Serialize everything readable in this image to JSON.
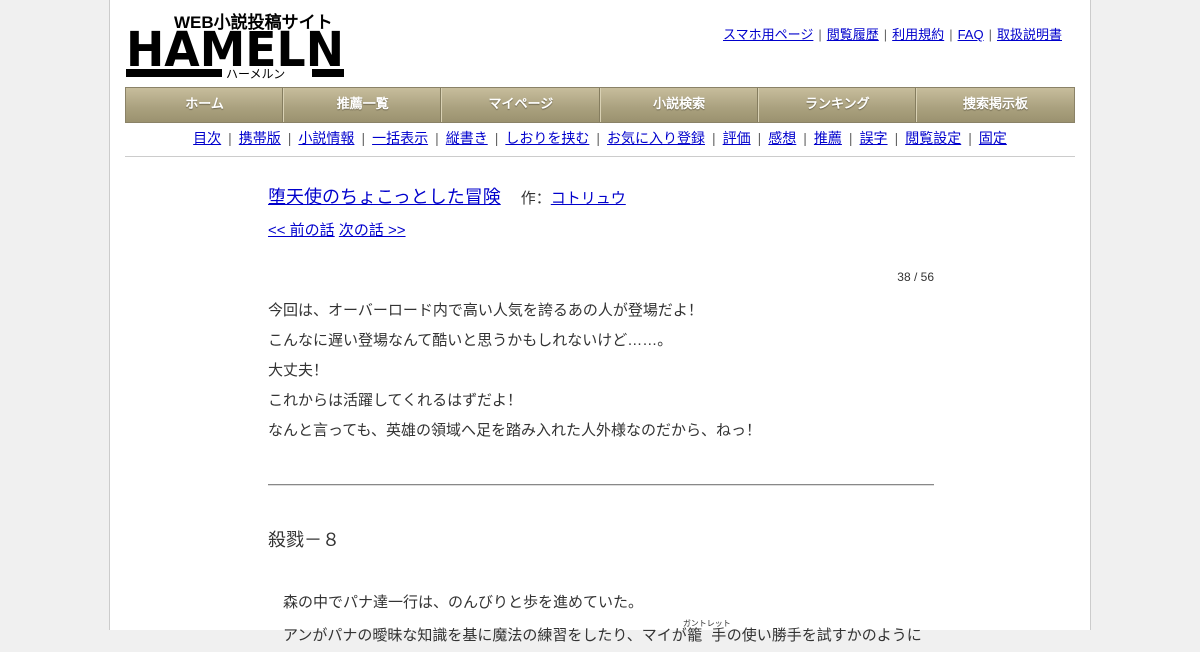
{
  "logo": {
    "small_text": "WEB小説投稿サイト",
    "main_text": "HAMELN",
    "kana_text": "ハーメルン"
  },
  "top_links": [
    "スマホ用ページ",
    "閲覧履歴",
    "利用規約",
    "FAQ",
    "取扱説明書"
  ],
  "main_nav": [
    "ホーム",
    "推薦一覧",
    "マイページ",
    "小説検索",
    "ランキング",
    "捜索掲示板"
  ],
  "sub_nav": [
    "目次",
    "携帯版",
    "小説情報",
    "一括表示",
    "縦書き",
    "しおりを挟む",
    "お気に入り登録",
    "評価",
    "感想",
    "推薦",
    "誤字",
    "閲覧設定",
    "固定"
  ],
  "novel": {
    "title": "堕天使のちょこっとした冒険",
    "author_prefix": "作：",
    "author": "コトリュウ",
    "prev": "<< 前の話",
    "next": "次の話 >>",
    "episode_count": "38 / 56",
    "foreword": [
      "今回は、オーバーロード内で高い人気を誇るあの人が登場だよ！",
      "こんなに遅い登場なんて酷いと思うかもしれないけど……。",
      "大丈夫！",
      "これからは活躍してくれるはずだよ！",
      "なんと言っても、英雄の領域へ足を踏み入れた人外様なのだから、ねっ！"
    ],
    "chapter_title": "殺戮－８",
    "body": {
      "line1": "森の中でパナ達一行は、のんびりと歩を進めていた。",
      "line2_a": "アンがパナの曖昧な知識を基に魔法の練習をしたり、マイが",
      "line2_ruby_base": "籠手",
      "line2_ruby_text": "ガントレット",
      "line2_b": "の使い勝手を試すかのように"
    }
  }
}
